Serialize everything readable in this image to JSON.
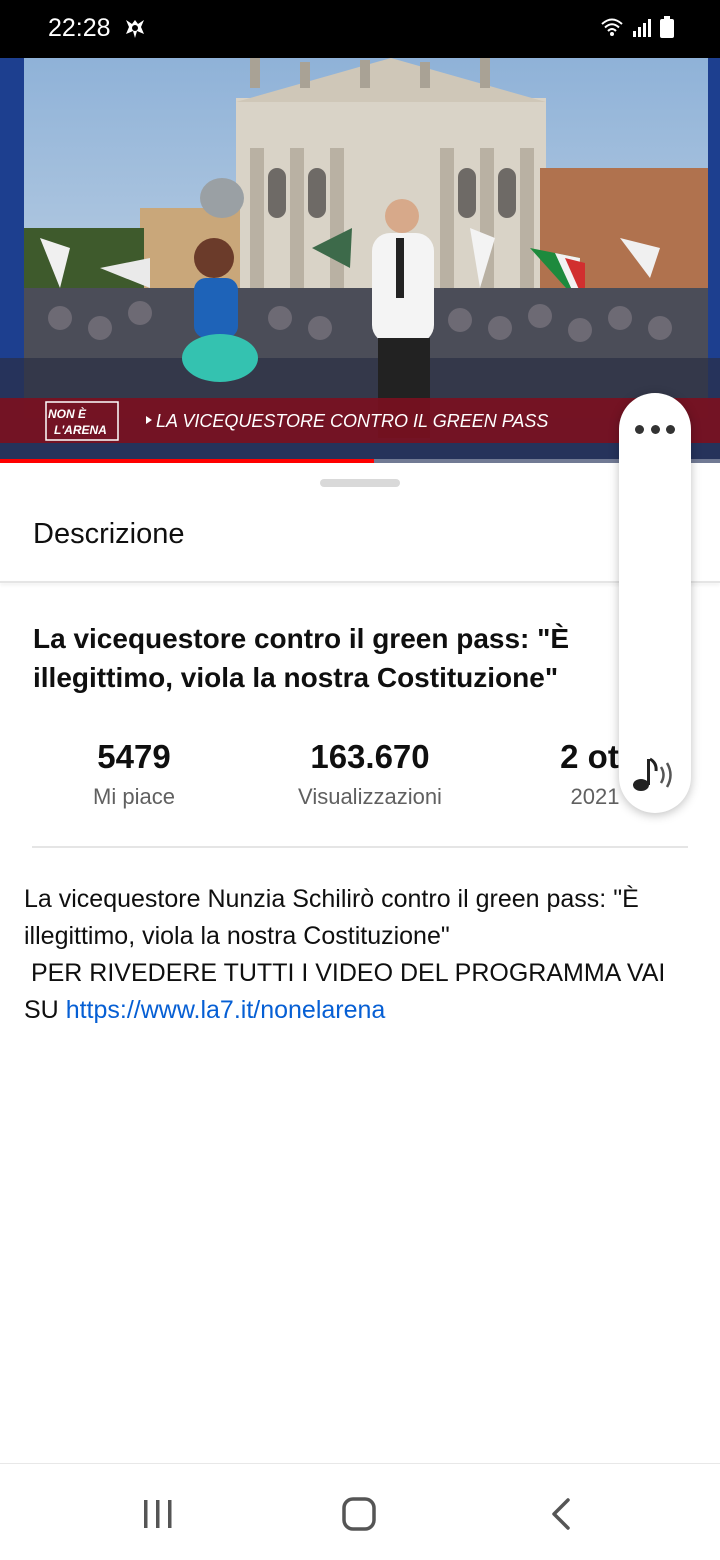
{
  "status_bar": {
    "time": "22:28",
    "app_icon": "ghost-notification-icon",
    "right_icons": [
      "wifi-icon",
      "signal-icon",
      "battery-icon"
    ]
  },
  "video": {
    "overlay_logo": "NON È L'ARENA",
    "overlay_banner": "LA VICEQUESTORE CONTRO IL GREEN PASS",
    "progress": 0.52,
    "accent_color": "#ff0000"
  },
  "sheet": {
    "title": "Descrizione"
  },
  "content": {
    "video_title": "La vicequestore contro il green pass: \"È illegittimo, viola la nostra Costituzione\"",
    "stats": {
      "likes_value": "5479",
      "likes_label": "Mi piace",
      "views_value": "163.670",
      "views_label": "Visualizzazioni",
      "date_value": "2 ott",
      "date_year": "2021"
    },
    "description": {
      "text": "La vicequestore Nunzia Schilirò contro il green pass: \"È illegittimo, viola la nostra Costituzione\"\n PER RIVEDERE TUTTI I VIDEO DEL PROGRAMMA VAI SU ",
      "link_text": "https://www.la7.it/nonelarena",
      "link_color": "#065fd4"
    }
  },
  "side_panel": {
    "more_icon": "more-horizontal-icon",
    "audio_icon": "music-audio-icon"
  },
  "nav_bar": {
    "buttons": [
      "recent-apps-icon",
      "home-icon",
      "back-icon"
    ]
  }
}
